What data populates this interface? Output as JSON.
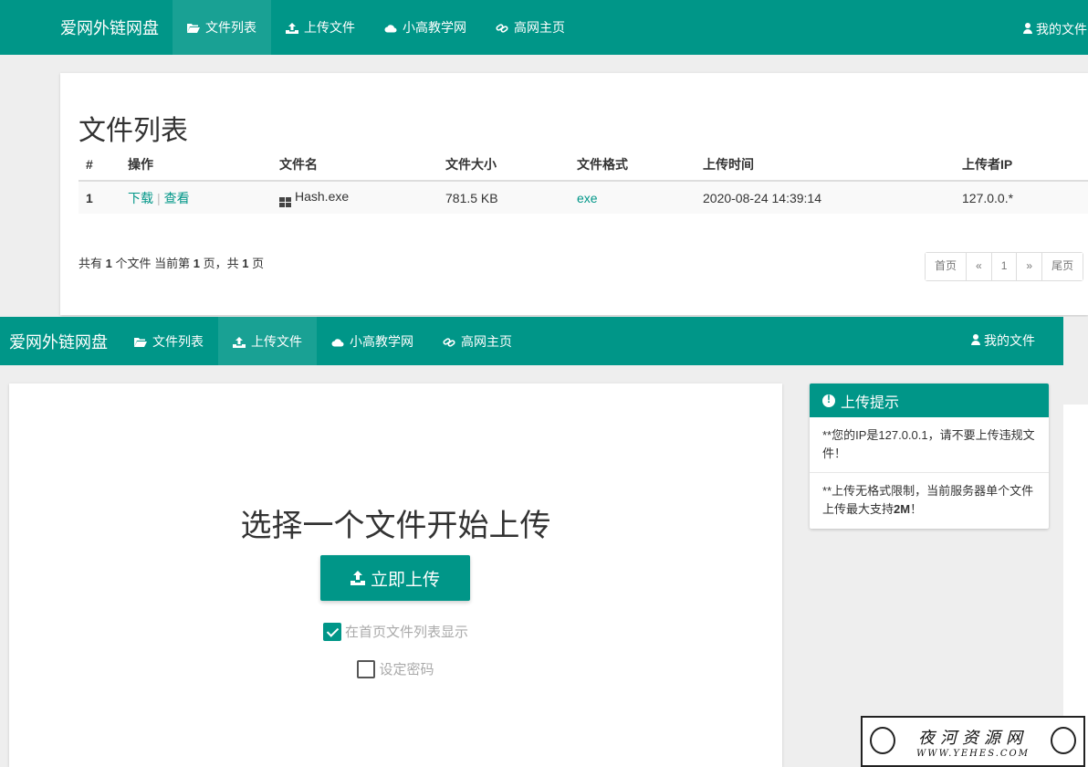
{
  "top": {
    "brand": "爱网外链网盘",
    "nav": [
      {
        "label": "文件列表",
        "icon": "folder-open-icon",
        "active": true
      },
      {
        "label": "上传文件",
        "icon": "upload-icon",
        "active": false
      },
      {
        "label": "小高教学网",
        "icon": "cloud-icon",
        "active": false
      },
      {
        "label": "高网主页",
        "icon": "link-icon",
        "active": false
      }
    ],
    "user_label": "我的文件",
    "heading": "文件列表",
    "table": {
      "headers": [
        "#",
        "操作",
        "文件名",
        "文件大小",
        "文件格式",
        "上传时间",
        "上传者IP"
      ],
      "rows": [
        {
          "num": "1",
          "download": "下载",
          "separator": "|",
          "view": "查看",
          "filename": "Hash.exe",
          "size": "781.5 KB",
          "format": "exe",
          "time": "2020-08-24 14:39:14",
          "ip": "127.0.0.*"
        }
      ]
    },
    "summary": {
      "prefix": "共有",
      "count": "1",
      "mid": "个文件 当前第",
      "page": "1",
      "mid2": "页，共",
      "total": "1",
      "suffix": "页"
    },
    "pager": {
      "first": "首页",
      "prev": "«",
      "current": "1",
      "next": "»",
      "last": "尾页"
    }
  },
  "bottom": {
    "brand": "爱网外链网盘",
    "nav": [
      {
        "label": "文件列表",
        "icon": "folder-open-icon",
        "active": false
      },
      {
        "label": "上传文件",
        "icon": "upload-icon",
        "active": true
      },
      {
        "label": "小高教学网",
        "icon": "cloud-icon",
        "active": false
      },
      {
        "label": "高网主页",
        "icon": "link-icon",
        "active": false
      }
    ],
    "user_label": "我的文件",
    "upload_title": "选择一个文件开始上传",
    "upload_button": "立即上传",
    "show_on_home_label": "在首页文件列表显示",
    "show_on_home_checked": true,
    "set_password_label": "设定密码",
    "set_password_checked": false,
    "tips": {
      "title": "上传提示",
      "tip1": {
        "text": "**您的IP是127.0.0.1，请不要上传违规文件！"
      },
      "tip2": {
        "prefix": "**上传无格式限制，当前服务器单个文件上传最大支持",
        "limit": "2M",
        "suffix": "！"
      }
    }
  },
  "watermark": {
    "title": "夜河资源网",
    "url": "WWW.YEHES.COM"
  },
  "colors": {
    "primary": "#009688",
    "nav_active": "#19a194"
  }
}
